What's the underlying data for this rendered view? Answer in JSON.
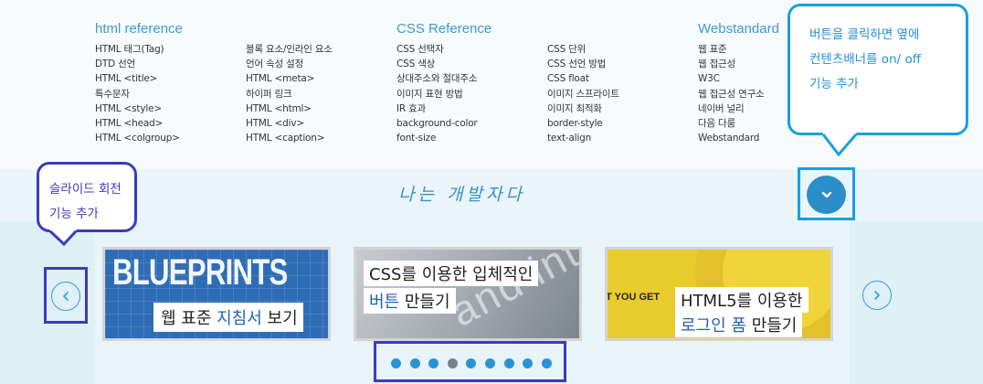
{
  "menu": {
    "columns": [
      {
        "title": "html reference",
        "items_left": [
          "HTML 태그(Tag)",
          "DTD 선언",
          "HTML <title>",
          "특수문자",
          "HTML <style>",
          "HTML <head>",
          "HTML <colgroup>"
        ],
        "items_right": [
          "블록 요소/인라인 요소",
          "언어 속성 설정",
          "HTML <meta>",
          "하이퍼 링크",
          "HTML <html>",
          "HTML <div>",
          "HTML <caption>"
        ]
      },
      {
        "title": "CSS Reference",
        "items_left": [
          "CSS 선택자",
          "CSS 색상",
          "상대주소와 절대주소",
          "이미지 표현 방법",
          "IR 효과",
          "background-color",
          "font-size"
        ],
        "items_right": [
          "CSS 단위",
          "CSS 선언 방법",
          "CSS float",
          "이미지 스프라이트",
          "이미지 최적화",
          "border-style",
          "text-align"
        ]
      },
      {
        "title": "Webstandard",
        "items_left": [
          "웹 표준",
          "웹 접근성",
          "W3C",
          "웹 접근성 연구소",
          "네이버 널리",
          "다음 다룸",
          "Webstandard"
        ]
      }
    ]
  },
  "slogan": "나는 개발자다",
  "callouts": {
    "toggle": [
      "버튼을 클릭하면 옆에",
      "컨텐츠배너를 on/ off",
      "기능 추가"
    ],
    "slide": [
      "슬라이드 회전",
      "기능 추가"
    ]
  },
  "slides": [
    {
      "heading": "BLUEPRINTS",
      "label_parts": [
        "웹 표준 ",
        "지침서",
        " 보기"
      ]
    },
    {
      "deco": "and inte",
      "line1": "CSS를 이용한 입체적인",
      "line2_parts": [
        "버튼",
        " 만들기"
      ]
    },
    {
      "small": "T YOU GET",
      "line1": "HTML5를 이용한",
      "line2_parts": [
        "로그인 폼",
        " 만들기"
      ]
    }
  ],
  "pagination": {
    "count": 9,
    "active_index": 3
  },
  "icons": {
    "toggle": "chevron-down-icon",
    "prev": "chevron-left-icon",
    "next": "chevron-right-icon"
  },
  "colors": {
    "accent": "#3a9ad2",
    "toggle_button": "#2a8ec9",
    "annotation_blue": "#1a9fe0",
    "annotation_indigo": "#3b3bbd",
    "dot": "#2a93d6",
    "dot_active": "#7a8288"
  }
}
